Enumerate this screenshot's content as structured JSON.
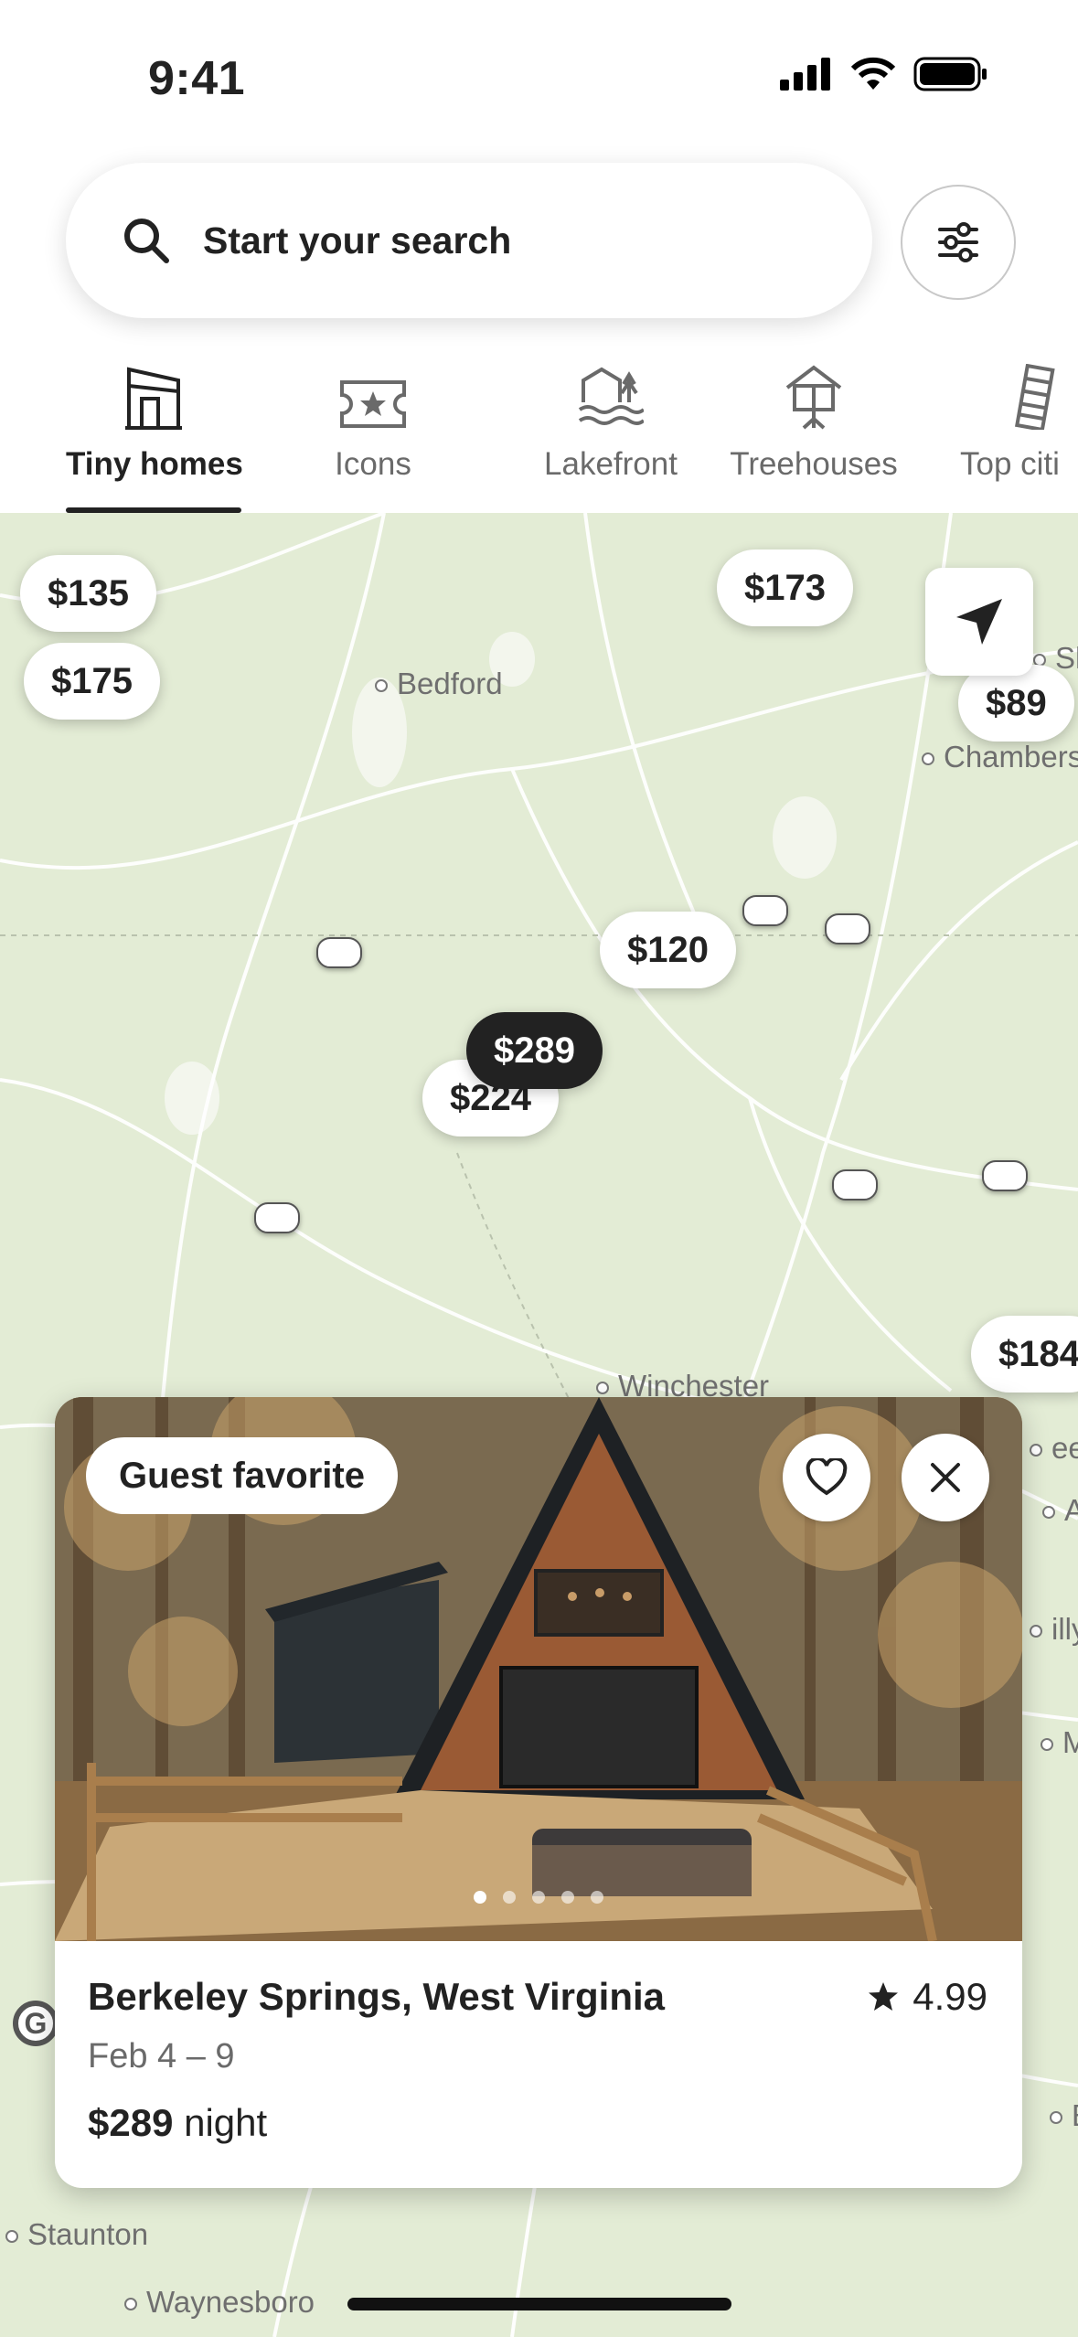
{
  "status_bar": {
    "time": "9:41"
  },
  "search": {
    "placeholder": "Start your search"
  },
  "categories": [
    {
      "label": "Tiny homes",
      "icon": "tiny-home-icon",
      "active": true
    },
    {
      "label": "Icons",
      "icon": "ticket-star-icon",
      "active": false
    },
    {
      "label": "Lakefront",
      "icon": "lakefront-icon",
      "active": false
    },
    {
      "label": "Treehouses",
      "icon": "treehouse-icon",
      "active": false
    },
    {
      "label": "Top citi",
      "icon": "leaning-tower-icon",
      "active": false
    }
  ],
  "map": {
    "price_pins": [
      "$135",
      "$175",
      "$173",
      "$89",
      "$120",
      "$289",
      "$224",
      "$184"
    ],
    "selected_pin": "$289",
    "towns": [
      "Bedford",
      "Chambers",
      "Winchester",
      "Staunton",
      "Waynesboro",
      "Shi",
      "eesl",
      "A",
      "illy",
      "M",
      "E"
    ]
  },
  "listing": {
    "badge": "Guest favorite",
    "title": "Berkeley Springs, West Virginia",
    "rating": "4.99",
    "dates": "Feb 4 – 9",
    "price": "$289",
    "price_unit": "night",
    "photo_count": 5,
    "active_photo": 1
  },
  "colors": {
    "map_bg": "#e3ecd5",
    "text": "#222222",
    "muted": "#6a6a6a"
  }
}
